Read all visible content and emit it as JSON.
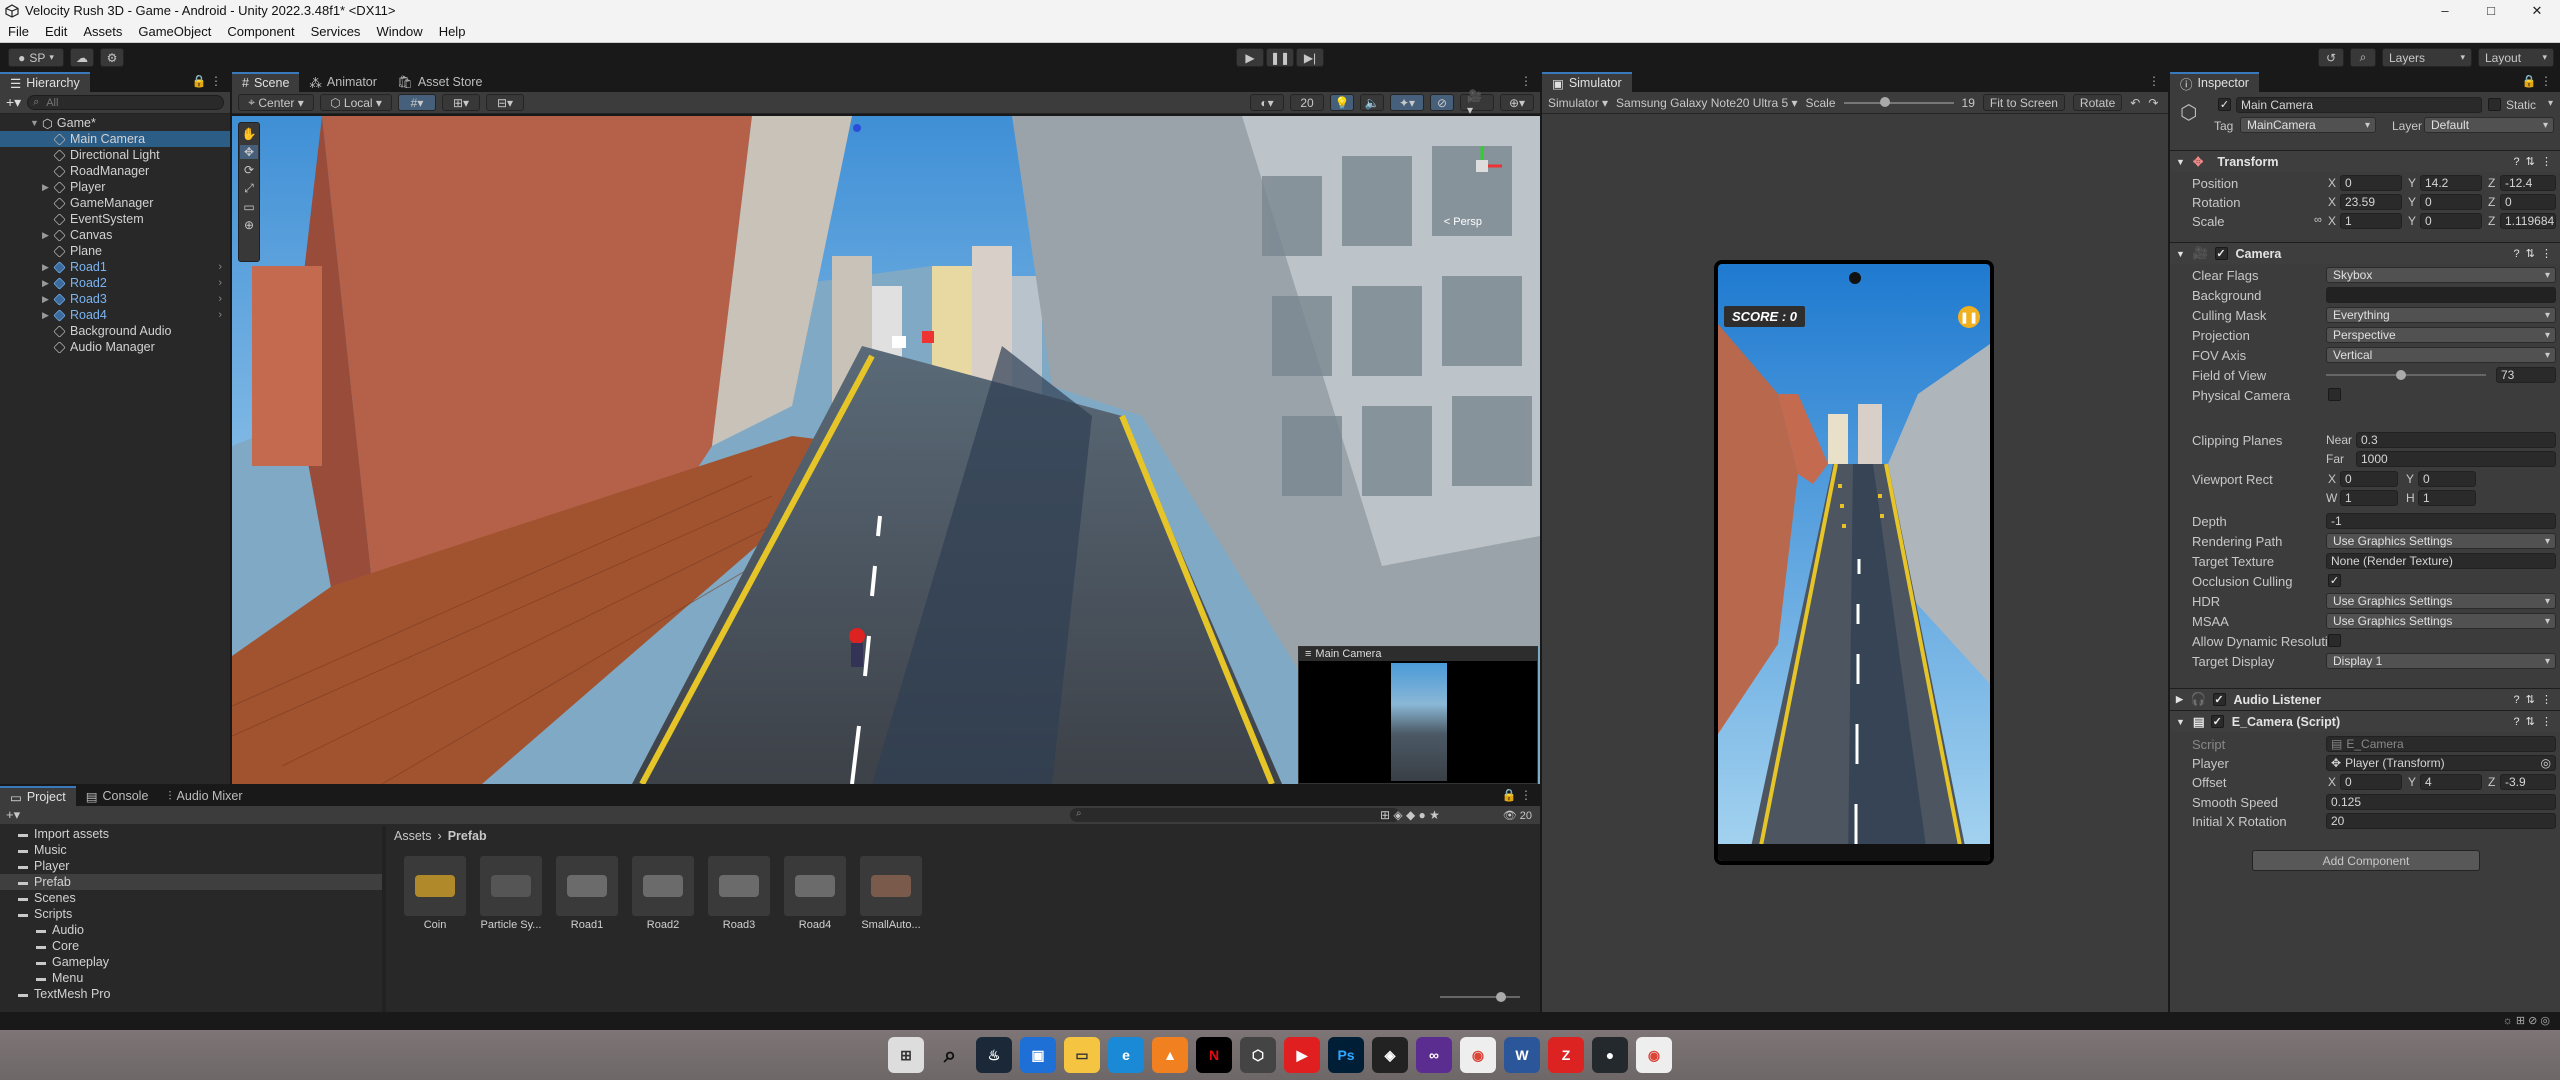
{
  "window": {
    "title": "Velocity Rush 3D - Game - Android - Unity 2022.3.48f1* <DX11>",
    "min": "–",
    "max": "□",
    "close": "✕"
  },
  "menu": [
    "File",
    "Edit",
    "Assets",
    "GameObject",
    "Component",
    "Services",
    "Window",
    "Help"
  ],
  "toolbar": {
    "account": "SP",
    "layers": "Layers",
    "layout": "Layout"
  },
  "hierarchy": {
    "tab": "Hierarchy",
    "search_placeholder": "All",
    "scene": "Game*",
    "items": [
      {
        "label": "Main Camera",
        "selected": true,
        "prefab": false,
        "expand": false
      },
      {
        "label": "Directional Light",
        "selected": false,
        "prefab": false,
        "expand": false
      },
      {
        "label": "RoadManager",
        "selected": false,
        "prefab": false,
        "expand": false
      },
      {
        "label": "Player",
        "selected": false,
        "prefab": false,
        "expand": true
      },
      {
        "label": "GameManager",
        "selected": false,
        "prefab": false,
        "expand": false
      },
      {
        "label": "EventSystem",
        "selected": false,
        "prefab": false,
        "expand": false
      },
      {
        "label": "Canvas",
        "selected": false,
        "prefab": false,
        "expand": true
      },
      {
        "label": "Plane",
        "selected": false,
        "prefab": false,
        "expand": false
      },
      {
        "label": "Road1",
        "selected": false,
        "prefab": true,
        "expand": true
      },
      {
        "label": "Road2",
        "selected": false,
        "prefab": true,
        "expand": true
      },
      {
        "label": "Road3",
        "selected": false,
        "prefab": true,
        "expand": true
      },
      {
        "label": "Road4",
        "selected": false,
        "prefab": true,
        "expand": true
      },
      {
        "label": "Background Audio",
        "selected": false,
        "prefab": false,
        "expand": false
      },
      {
        "label": "Audio Manager",
        "selected": false,
        "prefab": false,
        "expand": false
      }
    ]
  },
  "scene": {
    "tabs": [
      "Scene",
      "Animator",
      "Asset Store"
    ],
    "pivot": "Center",
    "space": "Local",
    "grid_value": "20",
    "persp": "< Persp",
    "preview_title": "Main Camera"
  },
  "simulator": {
    "tab": "Simulator",
    "mode": "Simulator",
    "device": "Samsung Galaxy Note20 Ultra 5",
    "scale_label": "Scale",
    "scale_value": "19",
    "fit": "Fit to Screen",
    "rotate": "Rotate",
    "score": "SCORE : 0"
  },
  "inspector": {
    "tab": "Inspector",
    "object_name": "Main Camera",
    "static": "Static",
    "tag_label": "Tag",
    "tag": "MainCamera",
    "layer_label": "Layer",
    "layer": "Default",
    "transform": {
      "title": "Transform",
      "position": {
        "label": "Position",
        "x": "0",
        "y": "14.2",
        "z": "-12.4"
      },
      "rotation": {
        "label": "Rotation",
        "x": "23.59",
        "y": "0",
        "z": "0"
      },
      "scale": {
        "label": "Scale",
        "x": "1",
        "y": "0",
        "z": "1.119684"
      }
    },
    "camera": {
      "title": "Camera",
      "rows": [
        {
          "label": "Clear Flags",
          "value": "Skybox",
          "kind": "drop"
        },
        {
          "label": "Background",
          "value": "",
          "kind": "color"
        },
        {
          "label": "Culling Mask",
          "value": "Everything",
          "kind": "drop"
        },
        {
          "label": "Projection",
          "value": "Perspective",
          "kind": "drop"
        },
        {
          "label": "FOV Axis",
          "value": "Vertical",
          "kind": "drop"
        },
        {
          "label": "Field of View",
          "value": "73",
          "kind": "slider"
        },
        {
          "label": "Physical Camera",
          "value": "",
          "kind": "check"
        }
      ],
      "clipping_label": "Clipping Planes",
      "near_label": "Near",
      "near": "0.3",
      "far_label": "Far",
      "far": "1000",
      "viewport_label": "Viewport Rect",
      "vx": "0",
      "vy": "0",
      "vw": "1",
      "vh": "1",
      "rows2": [
        {
          "label": "Depth",
          "value": "-1",
          "kind": "field"
        },
        {
          "label": "Rendering Path",
          "value": "Use Graphics Settings",
          "kind": "drop"
        },
        {
          "label": "Target Texture",
          "value": "None (Render Texture)",
          "kind": "obj"
        },
        {
          "label": "Occlusion Culling",
          "value": "✓",
          "kind": "check"
        },
        {
          "label": "HDR",
          "value": "Use Graphics Settings",
          "kind": "drop"
        },
        {
          "label": "MSAA",
          "value": "Use Graphics Settings",
          "kind": "drop"
        },
        {
          "label": "Allow Dynamic Resolutio",
          "value": "",
          "kind": "check"
        },
        {
          "label": "Target Display",
          "value": "Display 1",
          "kind": "drop"
        }
      ]
    },
    "audio_listener": "Audio Listener",
    "script_comp": {
      "title": "E_Camera (Script)",
      "script_label": "Script",
      "script": "E_Camera",
      "player_label": "Player",
      "player": "Player (Transform)",
      "offset_label": "Offset",
      "ox": "0",
      "oy": "4",
      "oz": "-3.9",
      "smooth_label": "Smooth Speed",
      "smooth": "0.125",
      "initx_label": "Initial X Rotation",
      "initx": "20"
    },
    "add_component": "Add Component"
  },
  "project": {
    "tabs": [
      "Project",
      "Console",
      "Audio Mixer"
    ],
    "folders": [
      {
        "label": "Import assets",
        "indent": 1
      },
      {
        "label": "Music",
        "indent": 1
      },
      {
        "label": "Player",
        "indent": 1
      },
      {
        "label": "Prefab",
        "indent": 1,
        "selected": true
      },
      {
        "label": "Scenes",
        "indent": 1
      },
      {
        "label": "Scripts",
        "indent": 1
      },
      {
        "label": "Audio",
        "indent": 2
      },
      {
        "label": "Core",
        "indent": 2
      },
      {
        "label": "Gameplay",
        "indent": 2
      },
      {
        "label": "Menu",
        "indent": 2
      },
      {
        "label": "TextMesh Pro",
        "indent": 1
      }
    ],
    "breadcrumb": [
      "Assets",
      "Prefab"
    ],
    "count": "20",
    "assets": [
      "Coin",
      "Particle Sy...",
      "Road1",
      "Road2",
      "Road3",
      "Road4",
      "SmallAuto..."
    ]
  },
  "colors": {
    "accent": "#3a79bb",
    "selection": "#2c5d87",
    "panel": "#282828"
  }
}
